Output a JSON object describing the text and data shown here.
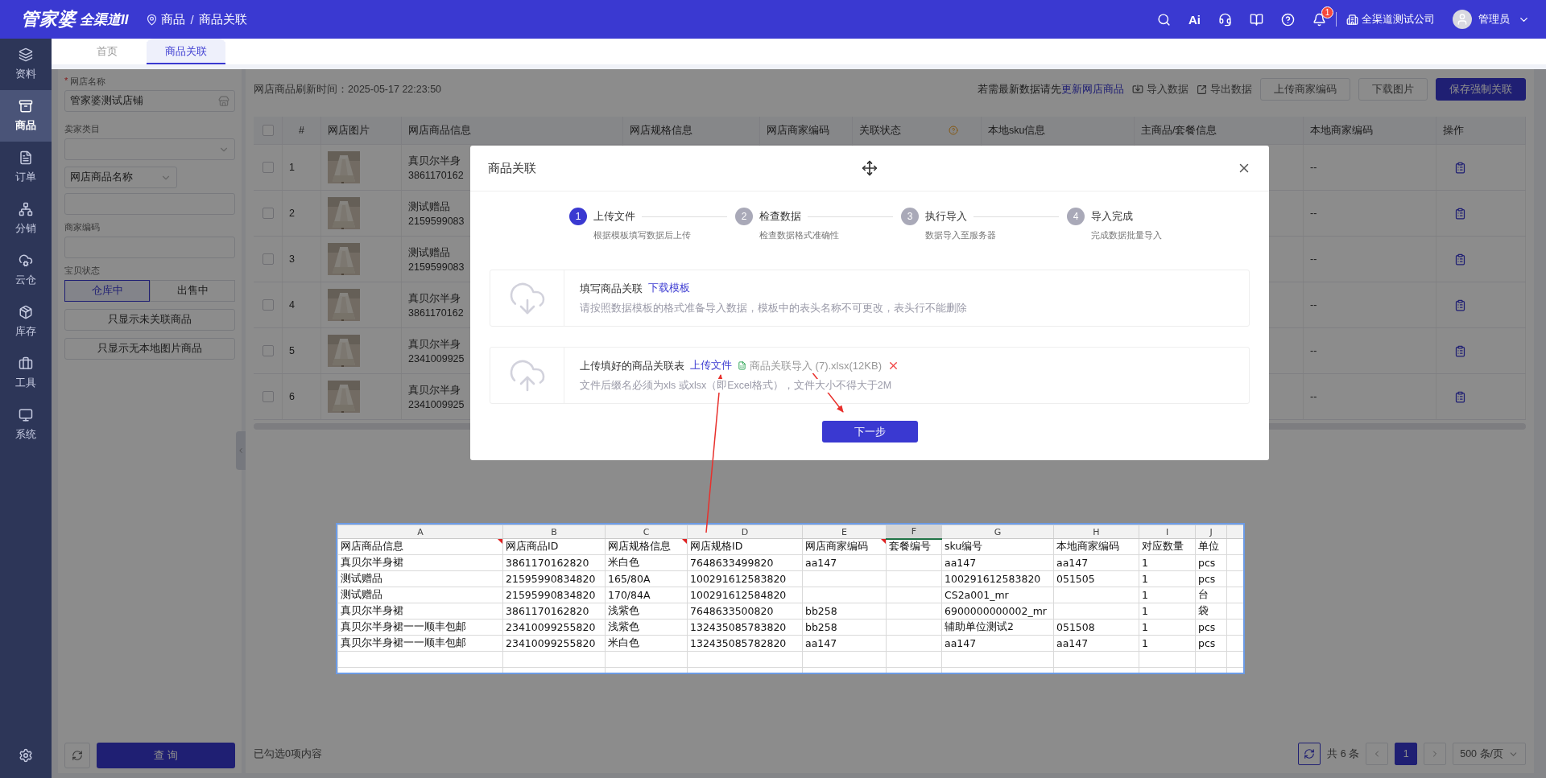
{
  "header": {
    "logo_main": "管家婆",
    "logo_sub": "全渠道II",
    "breadcrumb": [
      "商品",
      "商品关联"
    ],
    "breadcrumb_separator": "/",
    "ai_label": "Ai",
    "notification_count": "1",
    "company": "全渠道测试公司",
    "user": "管理员"
  },
  "sidebar": {
    "items": [
      {
        "label": "资料",
        "selected": false
      },
      {
        "label": "商品",
        "selected": true
      },
      {
        "label": "订单",
        "selected": false
      },
      {
        "label": "分销",
        "selected": false
      },
      {
        "label": "云仓",
        "selected": false
      },
      {
        "label": "库存",
        "selected": false
      },
      {
        "label": "工具",
        "selected": false
      },
      {
        "label": "系统",
        "selected": false
      }
    ]
  },
  "tabs": [
    {
      "label": "首页",
      "selected": false
    },
    {
      "label": "商品关联",
      "selected": true
    }
  ],
  "filters": {
    "required_mark": "*",
    "shop_label": "网店名称",
    "shop_value": "管家婆测试店铺",
    "category_label": "卖家类目",
    "search_field_type": "网店商品名称",
    "merchant_code_label": "商家编码",
    "status_label": "宝贝状态",
    "status_options": [
      {
        "label": "仓库中",
        "selected": true
      },
      {
        "label": "出售中",
        "selected": false
      }
    ],
    "toggle_buttons": [
      "只显示未关联商品",
      "只显示无本地图片商品"
    ],
    "query_button": "查 询"
  },
  "toolbar": {
    "refresh_time": "网店商品刷新时间：2025-05-17 22:23:50",
    "hint": "若需最新数据请先",
    "hint_link": "更新网店商品",
    "actions": [
      "导入数据",
      "导出数据"
    ],
    "buttons": [
      {
        "label": "上传商家编码",
        "kind": "default"
      },
      {
        "label": "下载图片",
        "kind": "default"
      },
      {
        "label": "保存强制关联",
        "kind": "primary"
      }
    ]
  },
  "table": {
    "select_all_checked": false,
    "columns": [
      "#",
      "网店图片",
      "网店商品信息",
      "网店规格信息",
      "网店商家编码",
      "关联状态",
      "本地sku信息",
      "主商品/套餐信息",
      "本地商家编码",
      "操作"
    ],
    "rows": [
      {
        "checked": false,
        "index": "1",
        "name": "真贝尔半身",
        "product_id": "3861170162",
        "local_code": "--"
      },
      {
        "checked": false,
        "index": "2",
        "name": "测试赠品",
        "product_id": "2159599083",
        "local_code": "--"
      },
      {
        "checked": false,
        "index": "3",
        "name": "测试赠品",
        "product_id": "2159599083",
        "local_code": "--"
      },
      {
        "checked": false,
        "index": "4",
        "name": "真贝尔半身",
        "product_id": "3861170162",
        "local_code": "--"
      },
      {
        "checked": false,
        "index": "5",
        "name": "真贝尔半身",
        "product_id": "2341009925",
        "local_code": "--"
      },
      {
        "checked": false,
        "index": "6",
        "name": "真贝尔半身",
        "product_id": "2341009925",
        "local_code": "--"
      }
    ]
  },
  "footer": {
    "selected_count": "已勾选0项内容",
    "total": "共 6 条",
    "pages": [
      {
        "label": "1",
        "selected": true
      }
    ],
    "page_size": "500 条/页"
  },
  "modal": {
    "title": "商品关联",
    "steps": [
      {
        "number": "1",
        "title": "上传文件",
        "description": "根据模板填写数据后上传",
        "selected": true
      },
      {
        "number": "2",
        "title": "检查数据",
        "description": "检查数据格式准确性",
        "selected": false
      },
      {
        "number": "3",
        "title": "执行导入",
        "description": "数据导入至服务器",
        "selected": false
      },
      {
        "number": "4",
        "title": "导入完成",
        "description": "完成数据批量导入",
        "selected": false
      }
    ],
    "cards": [
      {
        "kind": "download",
        "title": "填写商品关联",
        "link": "下载模板",
        "description": "请按照数据模板的格式准备导入数据，模板中的表头名称不可更改，表头行不能删除"
      },
      {
        "kind": "upload",
        "title": "上传填好的商品关联表",
        "link": "上传文件",
        "file": "商品关联导入 (7).xlsx(12KB)",
        "description": "文件后缀名必须为xls 或xlsx（即Excel格式），文件大小不得大于2M"
      }
    ],
    "next_button": "下一步"
  },
  "spreadsheet": {
    "columns": [
      {
        "label": "A",
        "selected": false
      },
      {
        "label": "B",
        "selected": false
      },
      {
        "label": "C",
        "selected": false
      },
      {
        "label": "D",
        "selected": false
      },
      {
        "label": "E",
        "selected": false
      },
      {
        "label": "F",
        "selected": true
      },
      {
        "label": "G",
        "selected": false
      },
      {
        "label": "H",
        "selected": false
      },
      {
        "label": "I",
        "selected": false
      },
      {
        "label": "J",
        "selected": false
      }
    ],
    "header": [
      {
        "text": "网店商品信息",
        "flagged": true
      },
      {
        "text": "网店商品ID",
        "flagged": false
      },
      {
        "text": "网店规格信息",
        "flagged": true
      },
      {
        "text": "网店规格ID",
        "flagged": false
      },
      {
        "text": "网店商家编码",
        "flagged": true
      },
      {
        "text": "套餐编号",
        "flagged": false
      },
      {
        "text": "sku编号",
        "flagged": false
      },
      {
        "text": "本地商家编码",
        "flagged": false
      },
      {
        "text": "对应数量",
        "flagged": false
      },
      {
        "text": "单位",
        "flagged": false
      }
    ],
    "rows": [
      {
        "a": "真贝尔半身裙",
        "b": "3861170162820",
        "c": "米白色",
        "d": "7648633499820",
        "e": "aa147",
        "g": "aa147",
        "h": "aa147",
        "i": "1",
        "j": "pcs"
      },
      {
        "a": "测试赠品",
        "b": "21595990834820",
        "c": "165/80A",
        "d": "100291612583820",
        "g": "100291612583820",
        "h": "051505",
        "i": "1",
        "j": "pcs"
      },
      {
        "a": "测试赠品",
        "b": "21595990834820",
        "c": "170/84A",
        "d": "100291612584820",
        "g": "CS2a001_mr",
        "i": "1",
        "j": "台"
      },
      {
        "a": "真贝尔半身裙",
        "b": "3861170162820",
        "c": "浅紫色",
        "d": "7648633500820",
        "e": "bb258",
        "g": "6900000000002_mr",
        "i": "1",
        "j": "袋"
      },
      {
        "a": "真贝尔半身裙一一顺丰包邮",
        "b": "23410099255820",
        "c": "浅紫色",
        "d": "132435085783820",
        "e": "bb258",
        "g": "辅助单位测试2",
        "h": "051508",
        "i": "1",
        "j": "pcs"
      },
      {
        "a": "真贝尔半身裙一一顺丰包邮",
        "b": "23410099255820",
        "c": "米白色",
        "d": "132435085782820",
        "e": "aa147",
        "g": "aa147",
        "h": "aa147",
        "i": "1",
        "j": "pcs"
      }
    ]
  }
}
